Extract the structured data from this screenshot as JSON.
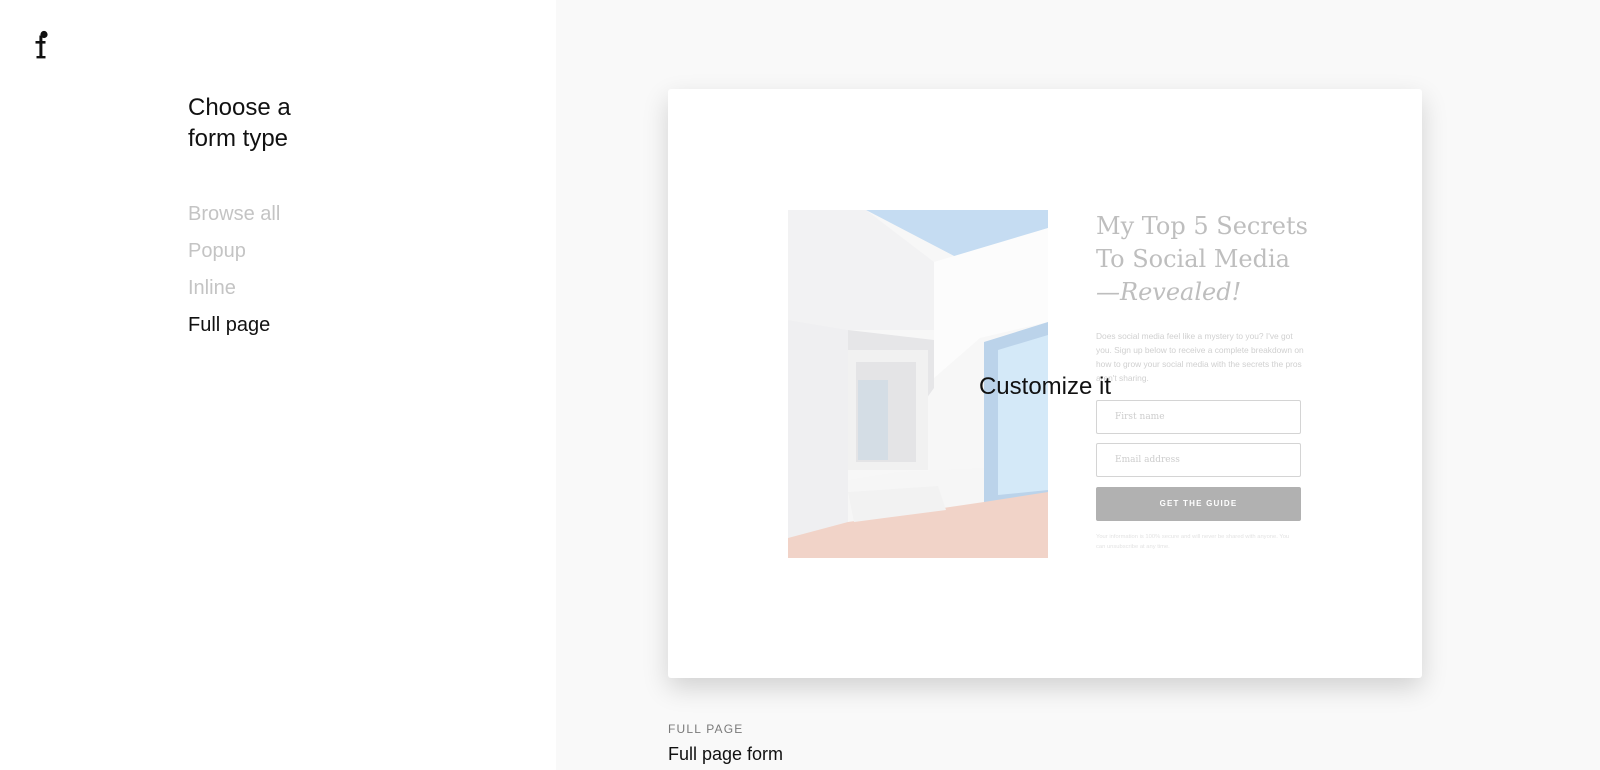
{
  "sidebar": {
    "logo": "f",
    "heading_line1": "Choose a",
    "heading_line2": "form type",
    "nav": [
      {
        "label": "Browse all",
        "active": false
      },
      {
        "label": "Popup",
        "active": false
      },
      {
        "label": "Inline",
        "active": false
      },
      {
        "label": "Full page",
        "active": true
      }
    ]
  },
  "card": {
    "hover_action": "Customize it",
    "preview": {
      "title_line1": "My Top 5 Secrets",
      "title_line2": "To Social Media",
      "title_line3": "—Revealed!",
      "description": "Does social media feel like a mystery to you? I've got you. Sign up below to receive a complete breakdown on how to grow your social media with the secrets the pros aren't sharing.",
      "first_name_placeholder": "First name",
      "email_placeholder": "Email address",
      "button_label": "GET THE GUIDE",
      "fine_print": "Your information is 100% secure and will never be shared with anyone. You can unsubscribe at any time."
    }
  },
  "template": {
    "category": "FULL PAGE",
    "name": "Full page form"
  },
  "colors": {
    "accent_text": "#111111",
    "inactive_nav": "#c4c4c4",
    "preview_button": "#b1b1b1"
  }
}
